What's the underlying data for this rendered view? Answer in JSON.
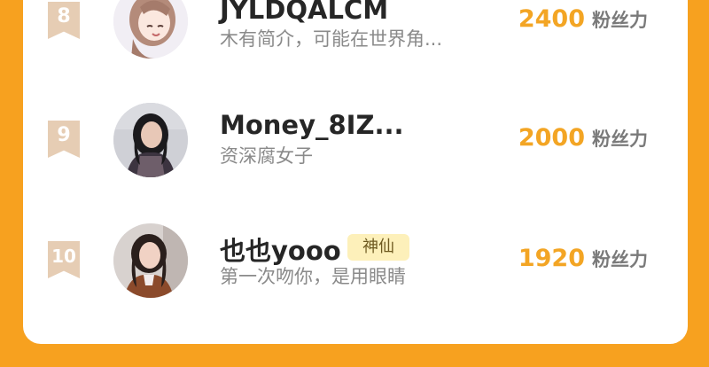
{
  "rows": [
    {
      "rank": "8",
      "name": "JYLDQALCM",
      "badge": "",
      "bio": "木有简介，可能在世界角...",
      "fans": "2400",
      "fans_unit": "粉丝力",
      "avatar": "anime-girl-avatar"
    },
    {
      "rank": "9",
      "name": "Money_8IZ...",
      "badge": "",
      "bio": "资深腐女子",
      "fans": "2000",
      "fans_unit": "粉丝力",
      "avatar": "woman-avatar"
    },
    {
      "rank": "10",
      "name": "也也yooo",
      "badge": "神仙",
      "bio": "第一次吻你，是用眼睛",
      "fans": "1920",
      "fans_unit": "粉丝力",
      "avatar": "woman-avatar"
    }
  ],
  "colors": {
    "background": "#f7a11f",
    "fans_number": "#f3a524",
    "rank_ribbon": "#e6cdb4",
    "badge_bg": "#fdf0ba"
  }
}
